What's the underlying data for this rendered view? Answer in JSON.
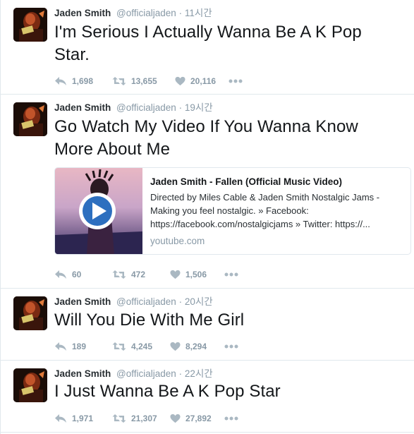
{
  "author": {
    "name": "Jaden Smith",
    "handle": "@officialjaden",
    "separator": "·"
  },
  "colors": {
    "text": "#14171a",
    "meta": "#8899a6",
    "border": "#e1e8ed"
  },
  "icons": {
    "reply": "reply-icon",
    "retweet": "retweet-icon",
    "like": "heart-icon",
    "more": "more-dots-icon"
  },
  "tweets": [
    {
      "time": "11시간",
      "text_lines": [
        "I'm Serious I Actually Wanna Be A K Pop",
        "Star."
      ],
      "replies": "1,698",
      "retweets": "13,655",
      "likes": "20,116"
    },
    {
      "time": "19시간",
      "text_lines": [
        "Go Watch My Video If You Wanna Know",
        "More About Me"
      ],
      "card": {
        "title": "Jaden Smith - Fallen (Official Music Video)",
        "description": "Directed by Miles Cable & Jaden Smith Nostalgic Jams - Making you feel nostalgic. » Facebook: https://facebook.com/nostalgicjams » Twitter: https://...",
        "domain": "youtube.com"
      },
      "replies": "60",
      "retweets": "472",
      "likes": "1,506"
    },
    {
      "time": "20시간",
      "text_lines": [
        "Will You Die With Me Girl"
      ],
      "replies": "189",
      "retweets": "4,245",
      "likes": "8,294"
    },
    {
      "time": "22시간",
      "text_lines": [
        "I Just Wanna Be A K Pop Star"
      ],
      "replies": "1,971",
      "retweets": "21,307",
      "likes": "27,892"
    }
  ]
}
